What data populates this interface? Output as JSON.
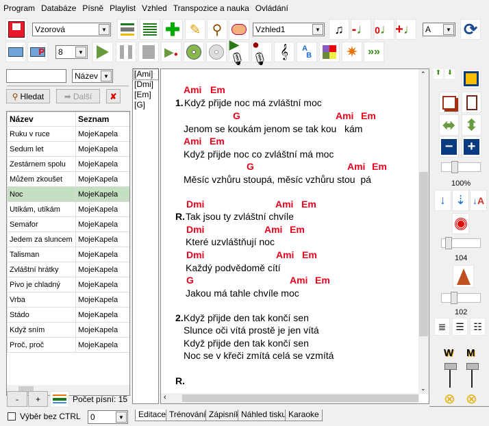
{
  "menu": [
    "Program",
    "Databáze",
    "Písně",
    "Playlist",
    "Vzhled",
    "Transpozice a nauka",
    "Ovládání"
  ],
  "toolbar": {
    "database_select": "Vzorová",
    "view_select": "Vzhled1",
    "key_select": "A",
    "font_size_select": "8"
  },
  "search": {
    "input_value": "",
    "field_select": "Název",
    "search_label": "Hledat",
    "next_label": "Další"
  },
  "song_table": {
    "headers": [
      "Název",
      "Seznam"
    ],
    "rows": [
      [
        "Ruku v ruce",
        "MojeKapela"
      ],
      [
        "Sedum let",
        "MojeKapela"
      ],
      [
        "Zestárnem spolu",
        "MojeKapela"
      ],
      [
        "Můžem zkoušet",
        "MojeKapela"
      ],
      [
        "Noc",
        "MojeKapela"
      ],
      [
        "Utíkám, utíkám",
        "MojeKapela"
      ],
      [
        "Semafor",
        "MojeKapela"
      ],
      [
        "Jedem za sluncem",
        "MojeKapela"
      ],
      [
        "Talisman",
        "MojeKapela"
      ],
      [
        "Zvláštní hrátky",
        "MojeKapela"
      ],
      [
        "Pivo je chladný",
        "MojeKapela"
      ],
      [
        "Vrba",
        "MojeKapela"
      ],
      [
        "Stádo",
        "MojeKapela"
      ],
      [
        "Když sním",
        "MojeKapela"
      ],
      [
        "Proč, proč",
        "MojeKapela"
      ]
    ],
    "selected": "Noc"
  },
  "bottom_left": {
    "minus": "-",
    "plus": "+",
    "song_count": "Počet písní: 15",
    "select_without_ctrl": "Výběr bez CTRL",
    "select_value": "0"
  },
  "chord_list": [
    "[Ami]",
    "[Dmi]",
    "[Em]",
    "[G]"
  ],
  "lyrics": {
    "l1_chords": [
      "Ami",
      "Em"
    ],
    "l1_num": "1.",
    "l1": "Když přijde noc má zvláštní moc",
    "l2_chords": [
      "G",
      "Ami",
      "Em"
    ],
    "l2": "Jenom se koukám jenom se tak kou   kám",
    "l3_chords": [
      "Ami",
      "Em"
    ],
    "l3": "Když přijde noc co zvláštní má moc",
    "l4_chords": [
      "G",
      "Ami",
      "Em"
    ],
    "l4": "Měsíc vzhůru stoupá, měsíc vzhůru stou  pá",
    "r1_chords": [
      "Dmi",
      "Ami",
      "Em"
    ],
    "r_num": "R.",
    "r1": "Tak jsou ty zvláštní chvíle",
    "r2_chords": [
      "Dmi",
      "Ami",
      "Em"
    ],
    "r2": "Které uzvláštňují noc",
    "r3_chords": [
      "Dmi",
      "Ami",
      "Em"
    ],
    "r3": "Každý podvědomě cítí",
    "r4_chords": [
      "G",
      "Ami",
      "Em"
    ],
    "r4": "Jakou má tahle chvíle moc",
    "v2_num": "2.",
    "v2": [
      "Když přijde den tak končí sen",
      "Slunce oči vítá prostě je jen vítá",
      "Když přijde den tak končí sen",
      "Noc se v křeči zmítá celá se vzmítá"
    ],
    "r_end": "R."
  },
  "tabs": [
    "Editace",
    "Trénování",
    "Zápisník",
    "Náhled tisku",
    "Karaoke"
  ],
  "right_panel": {
    "zoom_label": "100%",
    "tempo_label": "104",
    "metronome_label": "102",
    "zoom_value": 100,
    "tempo_value": 104,
    "metronome_value": 102,
    "w_label": "W",
    "m_label": "M"
  }
}
